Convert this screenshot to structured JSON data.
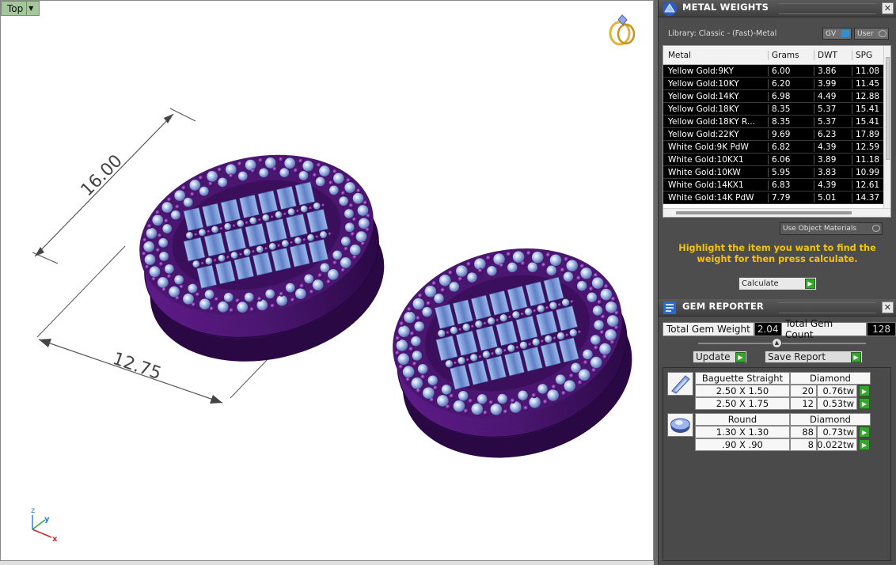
{
  "viewport": {
    "view_name": "Top",
    "dimension_width": "12.75",
    "dimension_length": "16.00",
    "axes": {
      "z": "z",
      "y": "y",
      "x": "x"
    }
  },
  "metal_weights": {
    "title": "METAL WEIGHTS",
    "library_label": "Library: Classic - (Fast)-Metal",
    "toggle_gv": "GV",
    "toggle_user": "User",
    "columns": [
      "Metal",
      "Grams",
      "DWT",
      "SPG"
    ],
    "rows": [
      {
        "metal": "Yellow Gold:9KY",
        "grams": "6.00",
        "dwt": "3.86",
        "spg": "11.08"
      },
      {
        "metal": "Yellow Gold:10KY",
        "grams": "6.20",
        "dwt": "3.99",
        "spg": "11.45"
      },
      {
        "metal": "Yellow Gold:14KY",
        "grams": "6.98",
        "dwt": "4.49",
        "spg": "12.88"
      },
      {
        "metal": "Yellow Gold:18KY",
        "grams": "8.35",
        "dwt": "5.37",
        "spg": "15.41"
      },
      {
        "metal": "Yellow Gold:18KY R...",
        "grams": "8.35",
        "dwt": "5.37",
        "spg": "15.41"
      },
      {
        "metal": "Yellow Gold:22KY",
        "grams": "9.69",
        "dwt": "6.23",
        "spg": "17.89"
      },
      {
        "metal": "White Gold:9K PdW",
        "grams": "6.82",
        "dwt": "4.39",
        "spg": "12.59"
      },
      {
        "metal": "White Gold:10KX1",
        "grams": "6.06",
        "dwt": "3.89",
        "spg": "11.18"
      },
      {
        "metal": "White Gold:10KW",
        "grams": "5.95",
        "dwt": "3.83",
        "spg": "10.99"
      },
      {
        "metal": "White Gold:14KX1",
        "grams": "6.83",
        "dwt": "4.39",
        "spg": "12.61"
      },
      {
        "metal": "White Gold:14K PdW",
        "grams": "7.79",
        "dwt": "5.01",
        "spg": "14.37"
      }
    ],
    "use_object_materials": "Use Object Materials",
    "hint": "Highlight the item you want to find the weight for then press calculate.",
    "calculate_label": "Calculate"
  },
  "gem_reporter": {
    "title": "GEM REPORTER",
    "total_weight_label": "Total Gem Weight",
    "total_weight_value": "2.04",
    "total_count_label": "Total Gem Count",
    "total_count_value": "128",
    "update_label": "Update",
    "save_report_label": "Save Report",
    "groups": [
      {
        "icon": "baguette-gem-icon",
        "shape": "Baguette Straight",
        "material": "Diamond",
        "items": [
          {
            "size": "2.50 X 1.50",
            "count": "20",
            "weight": "0.76tw"
          },
          {
            "size": "2.50 X 1.75",
            "count": "12",
            "weight": "0.53tw"
          }
        ]
      },
      {
        "icon": "round-gem-icon",
        "shape": "Round",
        "material": "Diamond",
        "items": [
          {
            "size": "1.30 X 1.30",
            "count": "88",
            "weight": "0.73tw"
          },
          {
            "size": ".90 X .90",
            "count": "8",
            "weight": "0.022tw"
          }
        ]
      }
    ]
  },
  "colors": {
    "metal": "#4a1670",
    "stone": "#8fb0e8",
    "accent_green": "#35a52e",
    "hint_yellow": "#f4c40d"
  }
}
